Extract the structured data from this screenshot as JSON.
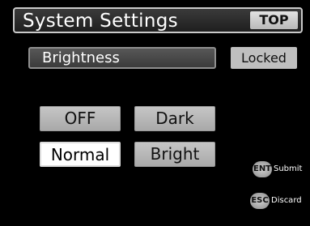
{
  "header": {
    "title": "System Settings",
    "top_label": "TOP"
  },
  "setting": {
    "name": "Brightness",
    "status": "Locked"
  },
  "options": {
    "off": "OFF",
    "dark": "Dark",
    "normal": "Normal",
    "bright": "Bright",
    "selected": "Normal"
  },
  "hints": {
    "submit_key": "ENT",
    "submit_label": "Submit",
    "discard_key": "ESC",
    "discard_label": "Discard"
  },
  "colors": {
    "background": "#000000",
    "button": "#bfbfbf",
    "selected_button": "#ffffff",
    "text_light": "#ffffff"
  }
}
